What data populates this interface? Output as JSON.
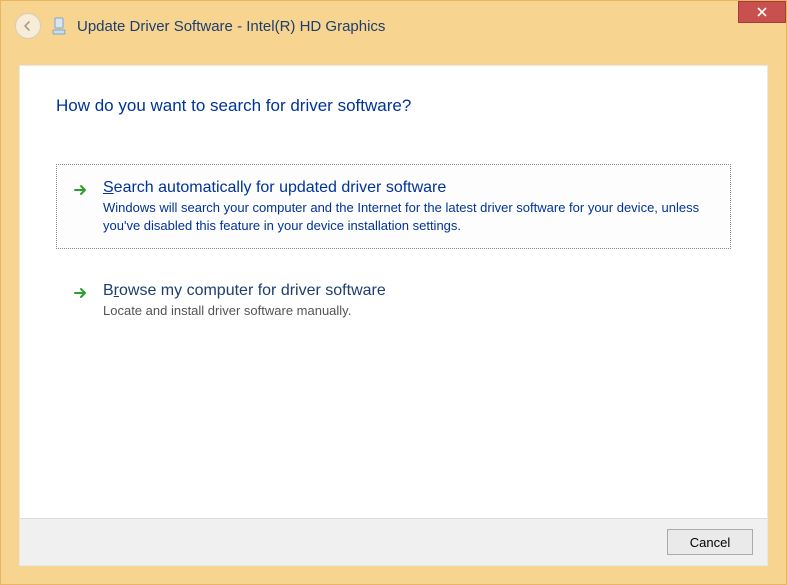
{
  "window_title": "Update Driver Software - Intel(R) HD Graphics",
  "heading": "How do you want to search for driver software?",
  "options": [
    {
      "title_prefix": "S",
      "title_rest": "earch automatically for updated driver software",
      "desc": "Windows will search your computer and the Internet for the latest driver software for your device, unless you've disabled this feature in your device installation settings."
    },
    {
      "title_prefix": "B",
      "title_mid": "r",
      "title_rest": "owse my computer for driver software",
      "desc": "Locate and install driver software manually."
    }
  ],
  "cancel_label": "Cancel"
}
